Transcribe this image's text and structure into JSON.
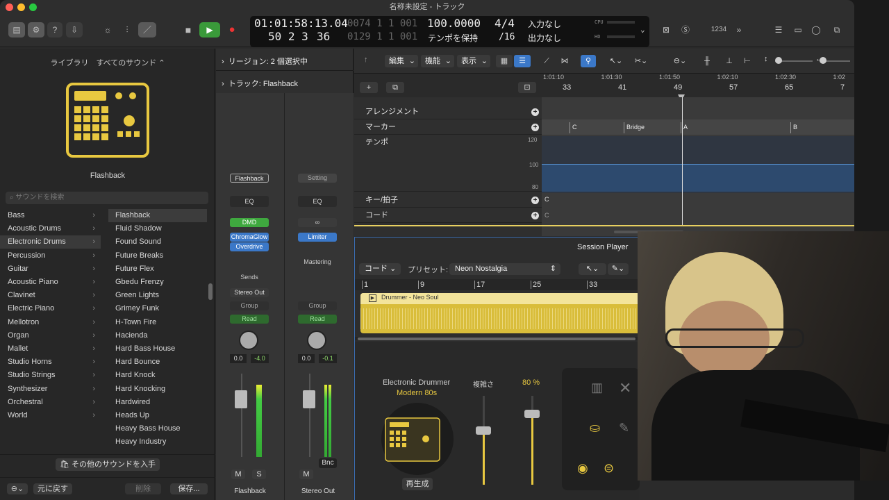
{
  "window": {
    "title": "名称未設定 - トラック"
  },
  "lcd": {
    "time": "01:01:58:13.04",
    "bars": "50  2  3",
    "ticks": "36",
    "bar_dim1": "0074  1  1  001",
    "bar_dim2": "0129  1  1  001",
    "tempo": "100.0000",
    "tempo_mode": "テンポを保持",
    "sig": "4/4",
    "div": "/16",
    "in": "入力なし",
    "out": "出力なし",
    "cpu": "CPU",
    "hd": "HD"
  },
  "toolbar": {
    "counter": "1234"
  },
  "library": {
    "header": "ライブラリ　すべてのサウンド ⌃",
    "patch_name": "Flashback",
    "search_placeholder": "サウンドを検索",
    "categories": [
      "Bass",
      "Acoustic Drums",
      "Electronic Drums",
      "Percussion",
      "Guitar",
      "Acoustic Piano",
      "Clavinet",
      "Electric Piano",
      "Mellotron",
      "Organ",
      "Mallet",
      "Studio Horns",
      "Studio Strings",
      "Synthesizer",
      "Orchestral",
      "World"
    ],
    "sounds": [
      "Flashback",
      "Fluid Shadow",
      "Found Sound",
      "Future Breaks",
      "Future Flex",
      "Gbedu Frenzy",
      "Green Lights",
      "Grimey Funk",
      "H-Town Fire",
      "Hacienda",
      "Hard Bass House",
      "Hard Bounce",
      "Hard Knock",
      "Hard Knocking",
      "Hardwired",
      "Heads Up",
      "Heavy Bass House",
      "Heavy Industry"
    ],
    "get_more": "その他のサウンドを入手",
    "revert": "元に戻す",
    "delete": "削除",
    "save": "保存..."
  },
  "inspector": {
    "region": "リージョン: 2 個選択中",
    "track": "トラック:  Flashback",
    "strip1": {
      "setting": "Flashback",
      "eq": "EQ",
      "p1": "DMD",
      "p2": "ChromaGlow",
      "p3": "Overdrive",
      "sends": "Sends",
      "out": "Stereo Out",
      "group": "Group",
      "auto": "Read",
      "v1": "0.0",
      "v2": "-4.0",
      "m": "M",
      "s": "S",
      "name": "Flashback"
    },
    "strip2": {
      "setting": "Setting",
      "eq": "EQ",
      "p1": "∞",
      "p2": "Limiter",
      "p3": "Mastering",
      "group": "Group",
      "auto": "Read",
      "v1": "0.0",
      "v2": "-0.1",
      "bnc": "Bnc",
      "m": "M",
      "name": "Stereo Out"
    }
  },
  "tracks": {
    "menus": [
      "編集",
      "機能",
      "表示"
    ],
    "ruler_time": [
      "1:01:10",
      "1:01:30",
      "1:01:50",
      "1:02:10",
      "1:02:30",
      "1:02"
    ],
    "ruler_bars": [
      "33",
      "41",
      "49",
      "57",
      "65",
      "7"
    ],
    "rows": [
      "アレンジメント",
      "マーカー",
      "テンポ",
      "キー/拍子",
      "コード"
    ],
    "markers": [
      "C",
      "Bridge",
      "A",
      "B"
    ],
    "tempo_scale": [
      "120",
      "100",
      "80"
    ],
    "key": "C",
    "chord": "C"
  },
  "session": {
    "title": "Session Player",
    "chord_menu": "コード",
    "preset_label": "プリセット:",
    "preset": "Neon Nostalgia",
    "bars": [
      "1",
      "9",
      "17",
      "25",
      "33"
    ],
    "region": "Drummer - Neo Soul",
    "drummer_type": "Electronic Drummer",
    "drummer_kit": "Modern 80s",
    "complexity": "複雑さ",
    "percent": "80 %",
    "regen": "再生成"
  },
  "colors": {
    "accent": "#e8c840",
    "blue": "#3b78c8",
    "green": "#3fa83f"
  }
}
